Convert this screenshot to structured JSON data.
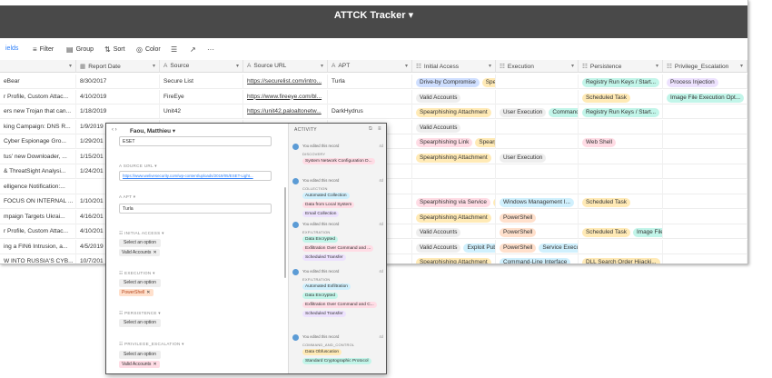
{
  "window": {
    "title": "ATTCK Tracker ▾"
  },
  "toolbar": [
    {
      "key": "fields",
      "label": "ields",
      "icon": ""
    },
    {
      "key": "filter",
      "label": "Filter",
      "icon": "≡"
    },
    {
      "key": "group",
      "label": "Group",
      "icon": "▤"
    },
    {
      "key": "sort",
      "label": "Sort",
      "icon": "⇅"
    },
    {
      "key": "color",
      "label": "Color",
      "icon": "◎"
    },
    {
      "key": "rowheight",
      "label": "",
      "icon": "☰"
    },
    {
      "key": "share",
      "label": "",
      "icon": "↗"
    },
    {
      "key": "more",
      "label": "",
      "icon": "···"
    }
  ],
  "columns": [
    {
      "label": "",
      "icon": ""
    },
    {
      "label": "Report Date",
      "icon": "▦"
    },
    {
      "label": "Source",
      "icon": "A"
    },
    {
      "label": "Source URL",
      "icon": "A"
    },
    {
      "label": "APT",
      "icon": "A"
    },
    {
      "label": "Initial Access",
      "icon": "☷"
    },
    {
      "label": "Execution",
      "icon": "☷"
    },
    {
      "label": "Persistence",
      "icon": "☷"
    },
    {
      "label": "Privilege_Escalation",
      "icon": "☷"
    }
  ],
  "rows": [
    {
      "name": "eBear",
      "date": "8/30/2017",
      "source": "Secure List",
      "url": "https://securelist.com/intro...",
      "apt": "Turla",
      "initial": [
        "Drive-by Compromise",
        "Spe"
      ],
      "execution": [],
      "persistence": [
        "Registry Run Keys / Start..."
      ],
      "privesc": [
        "Process Injection"
      ]
    },
    {
      "name": "r Profile, Custom Attac...",
      "date": "4/10/2019",
      "source": "FireEye",
      "url": "https://www.fireeye.com/bl...",
      "apt": "",
      "initial": [
        "Valid Accounts"
      ],
      "execution": [],
      "persistence": [
        "Scheduled Task"
      ],
      "privesc": [
        "Image File Execution Opt..."
      ]
    },
    {
      "name": "ers new Trojan that can...",
      "date": "1/18/2019",
      "source": "Unit42",
      "url": "https://unit42.paloaltonetw...",
      "apt": "DarkHydrus",
      "initial": [
        "Spearphishing Attachment"
      ],
      "execution": [
        "User Execution",
        "Command-"
      ],
      "persistence": [
        "Registry Run Keys / Start..."
      ],
      "privesc": []
    },
    {
      "name": "king Campaign: DNS R...",
      "date": "1/9/2019",
      "source": "",
      "url": "",
      "apt": "",
      "initial": [
        "Valid Accounts"
      ],
      "execution": [],
      "persistence": [],
      "privesc": []
    },
    {
      "name": "Cyber Espionage Gro...",
      "date": "1/29/201",
      "source": "",
      "url": "",
      "apt": "",
      "initial": [
        "Spearphishing Link",
        "Spearp"
      ],
      "execution": [],
      "persistence": [
        "Web Shell"
      ],
      "privesc": []
    },
    {
      "name": "tus' new Downloader, ...",
      "date": "1/15/201",
      "source": "",
      "url": "",
      "apt": "",
      "initial": [
        "Spearphishing Attachment"
      ],
      "execution": [
        "User Execution"
      ],
      "persistence": [],
      "privesc": []
    },
    {
      "name": "& ThreatSight Analysi...",
      "date": "1/24/201",
      "source": "",
      "url": "",
      "apt": "",
      "initial": [],
      "execution": [],
      "persistence": [],
      "privesc": []
    },
    {
      "name": "elligence Notification:...",
      "date": "",
      "source": "",
      "url": "",
      "apt": "",
      "initial": [],
      "execution": [],
      "persistence": [],
      "privesc": []
    },
    {
      "name": "FOCUS ON INTERNAL ...",
      "date": "1/10/201",
      "source": "",
      "url": "",
      "apt": "",
      "initial": [
        "Spearphishing via Service",
        "("
      ],
      "execution": [
        "Windows Management I..."
      ],
      "persistence": [
        "Scheduled Task"
      ],
      "privesc": []
    },
    {
      "name": "mpaign Targets Ukrai...",
      "date": "4/16/201",
      "source": "",
      "url": "",
      "apt": "",
      "initial": [
        "Spearphishing Attachment"
      ],
      "execution": [
        "PowerShell"
      ],
      "persistence": [],
      "privesc": []
    },
    {
      "name": "r Profile, Custom Attac...",
      "date": "4/10/201",
      "source": "",
      "url": "",
      "apt": "",
      "initial": [
        "Valid Accounts"
      ],
      "execution": [
        "PowerShell"
      ],
      "persistence": [
        "Scheduled Task",
        "Image File"
      ],
      "privesc": []
    },
    {
      "name": "ing a FIN6 Intrusion, a...",
      "date": "4/5/2019",
      "source": "",
      "url": "",
      "apt": "",
      "initial": [
        "Valid Accounts",
        "Exploit Pub"
      ],
      "execution": [
        "PowerShell",
        "Service Executi"
      ],
      "persistence": [],
      "privesc": []
    },
    {
      "name": "W INTO RUSSIA'S CYB...",
      "date": "10/7/201",
      "source": "",
      "url": "",
      "apt": "",
      "initial": [
        "Spearphishing Attachment"
      ],
      "execution": [
        "Command-Line Interface"
      ],
      "persistence": [
        "DLL Search Order Hijacki..."
      ],
      "privesc": []
    }
  ],
  "chip_colors": {
    "Drive-by Compromise": "#cfdfff",
    "Spe": "#ffeab6",
    "Spearp": "#ffeab6",
    "Valid Accounts": "#eeeeee",
    "Spearphishing Attachment": "#ffeab6",
    "Spearphishing Link": "#ffdce5",
    "Spearphishing via Service": "#ffdce5",
    "(": "#ffeab6",
    "Exploit Pub": "#d0f0fd",
    "User Execution": "#eeeeee",
    "Command-": "#c2f5e9",
    "Windows Management I...": "#d0f0fd",
    "PowerShell": "#ffe0cc",
    "Service Executi": "#d0f0fd",
    "Command-Line Interface": "#d0f0fd",
    "Registry Run Keys / Start...": "#c2f5e9",
    "Scheduled Task": "#ffeab6",
    "Web Shell": "#ffdce5",
    "Image File": "#c2f5e9",
    "DLL Search Order Hijacki...": "#ffeab6",
    "Process Injection": "#ede2fe",
    "Image File Execution Opt...": "#c2f5e9"
  },
  "popup": {
    "title": "Faou, Matthieu ▾",
    "first_value": "ESET",
    "source_url_label": "SOURCE URL ▾",
    "source_url": "https://www.welivesecurity.com/wp-content/uploads/2019/05/ESET-Light...",
    "apt_label": "APT ▾",
    "apt_value": "Turla",
    "initial_access_label": "INITIAL ACCESS ▾",
    "initial_access_select": "Select an option",
    "initial_access_chip": "Valid Accounts",
    "execution_label": "EXECUTION ▾",
    "execution_select": "Select an option",
    "execution_chip": "PowerShell",
    "persistence_label": "PERSISTENCE ▾",
    "persistence_select": "Select an option",
    "privesc_label": "PRIVILEGE_ESCALATION ▾",
    "privesc_select": "Select an option",
    "privesc_chip": "Valid Accounts",
    "activity_label": "ACTIVITY",
    "activity": [
      {
        "text": "You edited this record",
        "time": "4d",
        "field": "DISCOVERY",
        "chips": [
          {
            "label": "System Network Configuration D...",
            "color": "#ffdce5"
          }
        ]
      },
      {
        "text": "You edited this record",
        "time": "4d",
        "field": "COLLECTION",
        "chips": [
          {
            "label": "Automated Collection",
            "color": "#d0f0fd"
          },
          {
            "label": "Data from Local System",
            "color": "#ffdce5"
          },
          {
            "label": "Email Collection",
            "color": "#ede2fe"
          }
        ]
      },
      {
        "text": "You edited this record",
        "time": "4d",
        "field": "EXFILTRATION",
        "chips": [
          {
            "label": "Data Encrypted",
            "color": "#c2f5e9"
          },
          {
            "label": "Exfiltration Over Command and ...",
            "color": "#ffdce5"
          },
          {
            "label": "Scheduled Transfer",
            "color": "#ede2fe"
          }
        ]
      },
      {
        "text": "You edited this record",
        "time": "4d",
        "field": "EXFILTRATION",
        "chips": [
          {
            "label": "Automated Exfiltration",
            "color": "#d0f0fd"
          },
          {
            "label": "Data Encrypted",
            "color": "#c2f5e9"
          },
          {
            "label": "Exfiltration Over Command and C...",
            "color": "#ffdce5"
          },
          {
            "label": "Scheduled Transfer",
            "color": "#ede2fe"
          }
        ]
      },
      {
        "text": "You edited this record",
        "time": "4d",
        "field": "COMMAND_AND_CONTROL",
        "chips": [
          {
            "label": "Data Obfuscation",
            "color": "#ffeab6"
          },
          {
            "label": "Standard Cryptographic Protocol",
            "color": "#c2f5e9"
          }
        ]
      }
    ]
  }
}
